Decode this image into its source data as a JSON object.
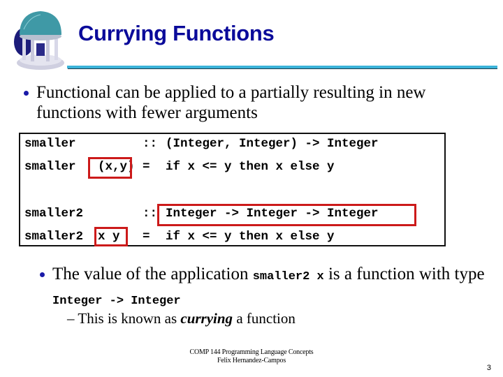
{
  "slide": {
    "title": "Currying Functions",
    "logo": "old-well-icon",
    "bullets": [
      {
        "text": "Functional can be applied to a partially resulting in new functions with fewer arguments"
      }
    ],
    "code": {
      "lines": [
        {
          "name": "smaller",
          "sep": "::",
          "body": "(Integer, Integer) -> Integer"
        },
        {
          "name": "smaller",
          "args": "(x,y)",
          "sep": "=",
          "body": "if x <= y then x else y"
        },
        {
          "name": "smaller2",
          "sep": "::",
          "body": "Integer -> Integer -> Integer"
        },
        {
          "name": "smaller2",
          "args": "x y",
          "sep": "=",
          "body": "if x <= y then x else y"
        }
      ],
      "highlighted": [
        "(x,y)",
        "Integer -> Integer -> Integer",
        "x y"
      ],
      "highlight_color": "#cc1a1a"
    },
    "bullet2": {
      "pre": "The value of the application ",
      "code1": "smaller2 x",
      "mid": " is a function with type ",
      "code2": "Integer -> Integer"
    },
    "sub_bullet": {
      "dash": "–",
      "pre": "This is known as ",
      "emph": "currying",
      "post": " a function"
    },
    "footer": {
      "course": "COMP 144 Programming Language Concepts",
      "author": "Felix Hernandez-Campos"
    },
    "page_number": "3",
    "colors": {
      "title": "#0a0a9a",
      "rule": "#3bb3d9",
      "bullet": "#1a1aa8"
    }
  }
}
